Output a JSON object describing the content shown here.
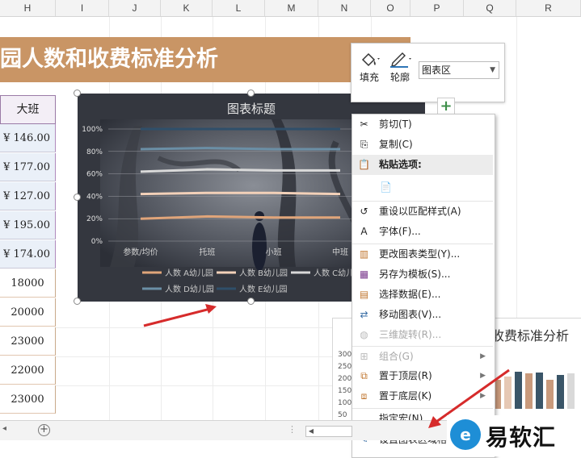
{
  "columns": [
    "H",
    "I",
    "J",
    "K",
    "L",
    "M",
    "N",
    "O",
    "P",
    "Q",
    "R"
  ],
  "sheet_title": "园人数和收费标准分析",
  "table": {
    "header": "大班",
    "money_rows": [
      "¥  146.00",
      "¥  177.00",
      "¥  127.00",
      "¥  195.00",
      "¥  174.00"
    ],
    "plain_rows": [
      "18000",
      "20000",
      "23000",
      "22000",
      "23000"
    ]
  },
  "format_toolbar": {
    "fill_label": "填充",
    "outline_label": "轮廓",
    "element_selected": "图表区"
  },
  "chart": {
    "title": "图表标题",
    "y_ticks": [
      "100%",
      "80%",
      "60%",
      "40%",
      "20%",
      "0%"
    ],
    "categories": [
      "参数/均价",
      "托班",
      "小班",
      "中班"
    ],
    "legend": [
      "人数 A幼儿园",
      "人数 B幼儿园",
      "人数 C幼儿",
      "人数 D幼儿园",
      "人数 E幼儿园"
    ]
  },
  "chart_data": {
    "type": "line",
    "title": "图表标题",
    "categories": [
      "参数/均价",
      "托班",
      "小班",
      "中班"
    ],
    "ylim": [
      0,
      1
    ],
    "series": [
      {
        "name": "人数 A幼儿园",
        "color": "#e0a57a",
        "values": [
          0.2,
          0.22,
          0.21,
          0.21
        ]
      },
      {
        "name": "人数 B幼儿园",
        "color": "#f3d1b9",
        "values": [
          0.42,
          0.43,
          0.43,
          0.42
        ]
      },
      {
        "name": "人数 C幼儿",
        "color": "#d9d9d9",
        "values": [
          0.62,
          0.64,
          0.63,
          0.63
        ]
      },
      {
        "name": "人数 D幼儿园",
        "color": "#6b8fa6",
        "values": [
          0.82,
          0.83,
          0.82,
          0.82
        ]
      },
      {
        "name": "人数 E幼儿园",
        "color": "#2f4f6a",
        "values": [
          1.0,
          1.0,
          1.0,
          1.0
        ]
      }
    ]
  },
  "context_menu": {
    "items": [
      {
        "label": "剪切(T)",
        "icon": "✂",
        "disabled": false
      },
      {
        "label": "复制(C)",
        "icon": "⎘",
        "disabled": false
      },
      {
        "label": "粘贴选项:",
        "icon": "📋",
        "disabled": true,
        "section": true
      },
      {
        "label": "",
        "icon": "📄",
        "disabled": true
      },
      {
        "label": "重设以匹配样式(A)",
        "icon": "↺",
        "disabled": false
      },
      {
        "label": "字体(F)...",
        "icon": "A",
        "disabled": false
      },
      {
        "label": "更改图表类型(Y)...",
        "icon": "▥",
        "disabled": false
      },
      {
        "label": "另存为模板(S)...",
        "icon": "▦",
        "disabled": false
      },
      {
        "label": "选择数据(E)...",
        "icon": "▤",
        "disabled": false
      },
      {
        "label": "移动图表(V)...",
        "icon": "⇄",
        "disabled": false
      },
      {
        "label": "三维旋转(R)...",
        "icon": "◍",
        "disabled": true
      },
      {
        "label": "组合(G)",
        "icon": "⊞",
        "disabled": true,
        "submenu": true
      },
      {
        "label": "置于顶层(R)",
        "icon": "⧉",
        "disabled": false,
        "submenu": true
      },
      {
        "label": "置于底层(K)",
        "icon": "⧈",
        "disabled": false,
        "submenu": true
      },
      {
        "label": "指定宏(N)...",
        "icon": "",
        "disabled": false
      },
      {
        "label": "设置图表区域格式(F)...",
        "icon": "✎",
        "disabled": false
      }
    ]
  },
  "chart2": {
    "title": "收费标准分析",
    "y_ticks": [
      "300",
      "250",
      "200",
      "150",
      "100",
      "50"
    ],
    "bars": [
      {
        "color": "#c99a7c",
        "value": 36
      },
      {
        "color": "#e6c8b4",
        "value": 40
      },
      {
        "color": "#3a5568",
        "value": 46
      },
      {
        "color": "#c99a7c",
        "value": 44
      },
      {
        "color": "#3a5568",
        "value": 45
      },
      {
        "color": "#c99a7c",
        "value": 36
      },
      {
        "color": "#3a5568",
        "value": 42
      },
      {
        "color": "#d9d9d9",
        "value": 44
      }
    ]
  },
  "watermark": {
    "logo": "e",
    "text": "易软汇"
  },
  "colors": {
    "title_band": "#c99565",
    "accent_arrow": "#d62b2b"
  }
}
